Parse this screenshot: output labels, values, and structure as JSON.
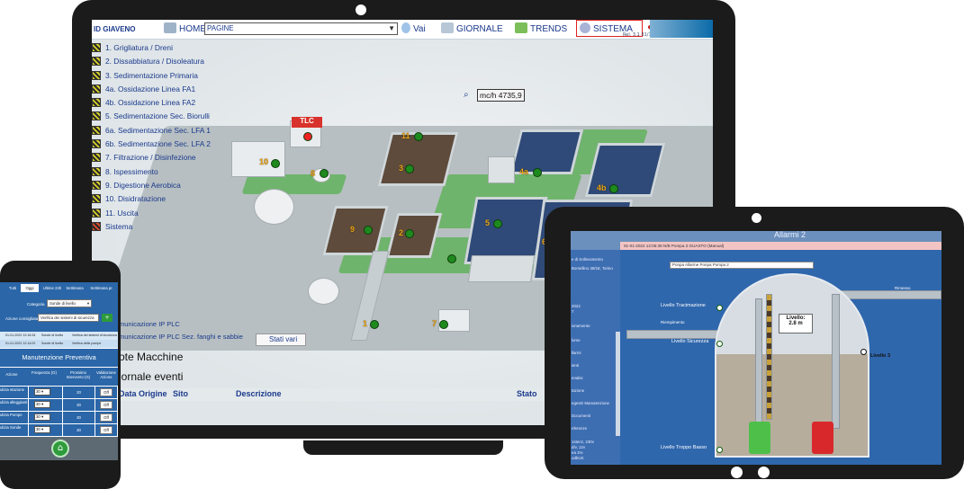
{
  "laptop": {
    "menubar": {
      "plant": "ID GIAVENO",
      "home": "HOME",
      "page_select": "PAGINE",
      "vai": "Vai",
      "giornale": "GIORNALE",
      "trends": "TRENDS",
      "sistema": "SISTEMA",
      "version": "Rel. 3.1 31/10/2017"
    },
    "menu": [
      {
        "label": "1. Grigliatura / Dreni"
      },
      {
        "label": "2. Dissabbiatura / Disoleatura"
      },
      {
        "label": "3. Sedimentazione Primaria"
      },
      {
        "label": "4a. Ossidazione Linea FA1"
      },
      {
        "label": "4b. Ossidazione Linea FA2"
      },
      {
        "label": "5. Sedimentazione Sec. Biorulli"
      },
      {
        "label": "6a. Sedimentazione Sec. LFA 1"
      },
      {
        "label": "6b. Sedimentazione Sec. LFA 2"
      },
      {
        "label": "7. Filtrazione / Disinfezione"
      },
      {
        "label": "8. Ispessimento"
      },
      {
        "label": "9. Digestione Aerobica"
      },
      {
        "label": "10. Disidratazione"
      },
      {
        "label": "11. Uscita"
      },
      {
        "label": "Sistema"
      }
    ],
    "flow_reading": "mc/h 4735,9",
    "tlc": "TLC",
    "plant_numbers": [
      "11",
      "10",
      "3",
      "4a",
      "4b",
      "8",
      "9",
      "2",
      "5",
      "6",
      "1",
      "7"
    ],
    "comm1": "municazione IP PLC",
    "comm2": "municazione IP PLC Sez. fanghi e sabbie",
    "stati": "Stati vari",
    "note": "ote Macchine",
    "giornale_eventi": "iornale eventi",
    "event_columns": [
      "Data Origine",
      "Sito",
      "Descrizione",
      "Stato"
    ]
  },
  "tablet": {
    "title": "Allarmi 2",
    "alarm": "01-01-2022 12:05:38   N/B Pompa 2   GUASTO (Manual)",
    "side": [
      "e di Sollevamento",
      "Borsellino 38/18, Torino",
      "2022",
      "7",
      "ionamento",
      "lome",
      "llarmi",
      "ienti",
      "enalisi",
      "tazione",
      "egestri Manutenzione",
      "Documenti",
      "eferenze",
      "1stenz, 230v",
      "d/v, 12v",
      "ea 1%",
      "odbUS"
    ],
    "search": "Ponpa Allarme Ponpa Pompa 2",
    "labels": {
      "tracimazione": "Livello Tracimazione",
      "sicurezza": "Livello Sicurezza",
      "troppo_basso": "Livello Troppo Basso",
      "livello3": "Livello 3",
      "riempimento": "Riempimento",
      "rimesso": "Rimesso",
      "livello_title": "Livello:",
      "livello_value": "2.8 m"
    }
  },
  "phone": {
    "tabs": [
      "Tutti",
      "Oggi",
      "Ultime 24h",
      "Settimana",
      "Settimana pr."
    ],
    "categoria_label": "Categoria",
    "categoria_value": "Sonde di livello",
    "azione_label": "Azione consigliata",
    "azione_value": "Verifica dei sistemi di sicurezza",
    "events": [
      {
        "date": "01-01-2022 12:16:34",
        "type": "Sonde di livello",
        "text": "Verifica dei sistemi di sicurezza"
      },
      {
        "date": "01-01-2022 12:14:02",
        "type": "Sonde di livello",
        "text": "Verifica delle pompe"
      }
    ],
    "maint_title": "Manutenzione Preventiva",
    "columns": [
      "Azione",
      "Frequenza (G)",
      "Prossimo Intervento (G)",
      "Validazione Azione"
    ],
    "rows": [
      {
        "azione": "ulizia stazione",
        "freq": "30",
        "next": "20",
        "btn": "Off"
      },
      {
        "azione": "ulizia alleggianti",
        "freq": "30",
        "next": "30",
        "btn": "Off"
      },
      {
        "azione": "ulizia Pompe",
        "freq": "30",
        "next": "30",
        "btn": "Off"
      },
      {
        "azione": "ulizia Sonde",
        "freq": "30",
        "next": "30",
        "btn": "Off"
      }
    ]
  },
  "colors": {
    "brand_blue": "#2a66a8",
    "menu_text": "#1b3a8c",
    "ok_green": "#1e8a1e",
    "alarm_red": "#e22"
  }
}
